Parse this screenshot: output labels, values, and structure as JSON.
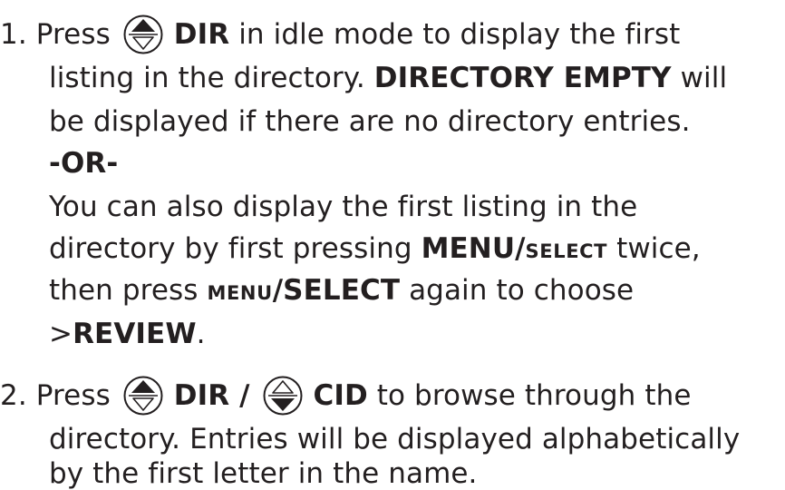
{
  "step1": {
    "number": "1.",
    "press": "Press",
    "dir": "DIR",
    "l1_rest": "in idle mode to display the first",
    "l2_pre": "listing in the directory.",
    "directory_empty": "DIRECTORY EMPTY",
    "l2_post": "will",
    "l3": "be displayed if there are no directory entries.",
    "or": "-OR-",
    "l5": "You can also display the first listing in the",
    "l6_pre": "directory by first pressing",
    "menu_a": "MENU/",
    "select_a": "SELECT",
    "l6_post": "twice,",
    "l7_pre": "then press",
    "menu_b": "MENU",
    "select_b": "/SELECT",
    "l7_post": "again to choose",
    "gt": ">",
    "review": "REVIEW",
    "period": "."
  },
  "step2": {
    "number": "2.",
    "press": "Press",
    "dir_slash": "DIR /",
    "cid": "CID",
    "l1_rest": "to browse through the",
    "l2": "directory. Entries will be displayed alphabetically",
    "l3": "by the first letter in the name."
  },
  "icons": {
    "up_key": "up-arrow-key-icon",
    "down_key": "down-arrow-key-icon",
    "ink": "#231f20"
  }
}
